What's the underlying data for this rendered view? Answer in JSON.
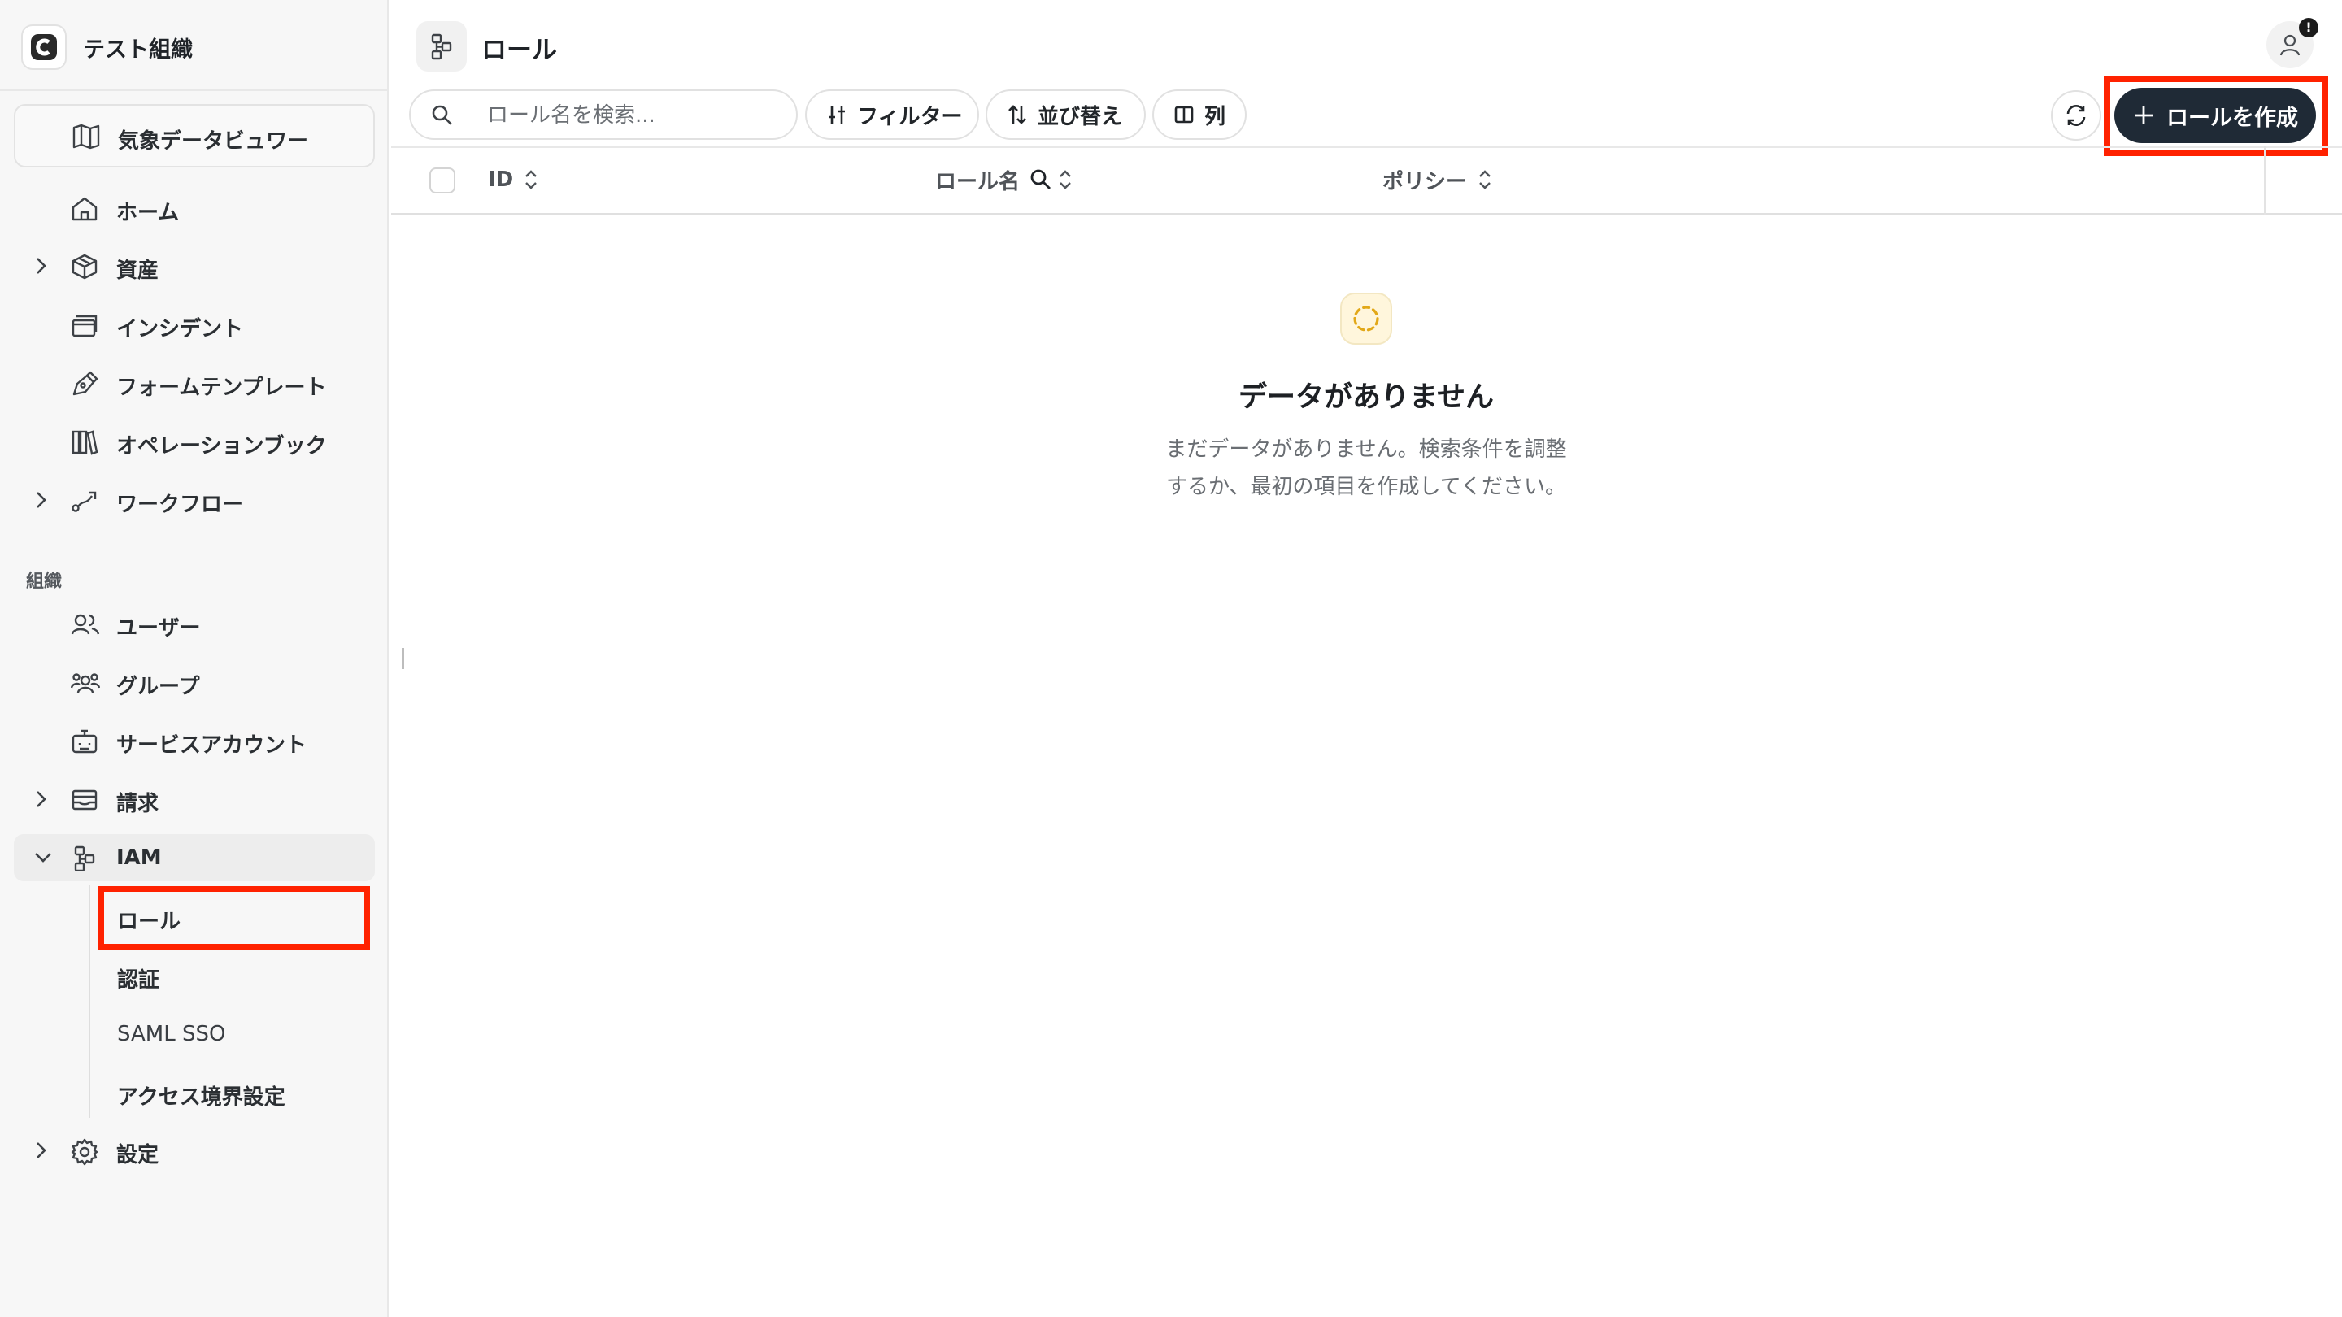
{
  "org": {
    "name": "テスト組織"
  },
  "app_switcher": {
    "label": "気象データビュワー"
  },
  "nav": {
    "home": "ホーム",
    "assets": "資産",
    "incidents": "インシデント",
    "form_templates": "フォームテンプレート",
    "operation_books": "オペレーションブック",
    "workflows": "ワークフロー"
  },
  "org_section": {
    "title": "組織",
    "users": "ユーザー",
    "groups": "グループ",
    "service_accounts": "サービスアカウント",
    "billing": "請求",
    "iam": "IAM",
    "iam_children": [
      "ロール",
      "認証",
      "SAML SSO",
      "アクセス境界設定"
    ],
    "settings": "設定"
  },
  "header": {
    "title": "ロール",
    "notification_badge": "!"
  },
  "toolbar": {
    "search_placeholder": "ロール名を検索...",
    "filter_label": "フィルター",
    "sort_label": "並び替え",
    "columns_label": "列",
    "create_label": "ロールを作成"
  },
  "table": {
    "columns": [
      "ID",
      "ロール名",
      "ポリシー"
    ]
  },
  "empty_state": {
    "title": "データがありません",
    "description_line1": "まだデータがありません。検索条件を調整",
    "description_line2": "するか、最初の項目を作成してください。"
  },
  "colors": {
    "primary_button": "#1f2a36",
    "highlight": "#ff2200",
    "empty_icon": "#e2a818"
  }
}
